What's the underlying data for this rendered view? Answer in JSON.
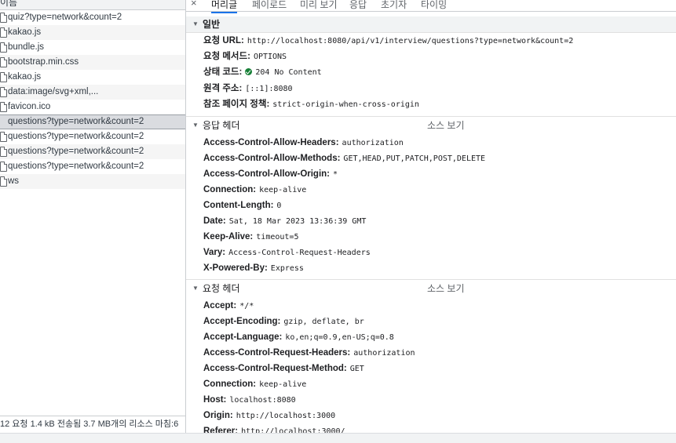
{
  "left_panel": {
    "column_header": "이름",
    "requests": [
      {
        "name": "quiz?type=network&count=2"
      },
      {
        "name": "kakao.js"
      },
      {
        "name": "bundle.js"
      },
      {
        "name": "bootstrap.min.css"
      },
      {
        "name": "kakao.js"
      },
      {
        "name": "data:image/svg+xml,..."
      },
      {
        "name": "favicon.ico"
      },
      {
        "name": "questions?type=network&count=2",
        "selected": true
      },
      {
        "name": "questions?type=network&count=2"
      },
      {
        "name": "questions?type=network&count=2"
      },
      {
        "name": "questions?type=network&count=2"
      },
      {
        "name": "ws"
      }
    ],
    "status_bar": "12 요청  1.4 kB 전송됨  3.7 MB개의 리소스  마침:6"
  },
  "tabs": {
    "close_icon": "×",
    "items": [
      "머리글",
      "페이로드",
      "미리 보기",
      "응답",
      "초기자",
      "타이밍"
    ],
    "active": 0
  },
  "general": {
    "title": "일반",
    "fields": [
      {
        "key": "요청 URL:",
        "value": "http://localhost:8080/api/v1/interview/questions?type=network&count=2"
      },
      {
        "key": "요청 메서드:",
        "value": "OPTIONS"
      },
      {
        "key": "상태 코드:",
        "value": "204 No Content",
        "status_icon": "check-circle-icon",
        "status_color": "#188038"
      },
      {
        "key": "원격 주소:",
        "value": "[::1]:8080"
      },
      {
        "key": "참조 페이지 정책:",
        "value": "strict-origin-when-cross-origin"
      }
    ]
  },
  "response_headers": {
    "title": "응답 헤더",
    "view_source": "소스 보기",
    "fields": [
      {
        "key": "Access-Control-Allow-Headers:",
        "value": "authorization"
      },
      {
        "key": "Access-Control-Allow-Methods:",
        "value": "GET,HEAD,PUT,PATCH,POST,DELETE"
      },
      {
        "key": "Access-Control-Allow-Origin:",
        "value": "*"
      },
      {
        "key": "Connection:",
        "value": "keep-alive"
      },
      {
        "key": "Content-Length:",
        "value": "0"
      },
      {
        "key": "Date:",
        "value": "Sat, 18 Mar 2023 13:36:39 GMT"
      },
      {
        "key": "Keep-Alive:",
        "value": "timeout=5"
      },
      {
        "key": "Vary:",
        "value": "Access-Control-Request-Headers"
      },
      {
        "key": "X-Powered-By:",
        "value": "Express"
      }
    ]
  },
  "request_headers": {
    "title": "요청 헤더",
    "view_source": "소스 보기",
    "fields": [
      {
        "key": "Accept:",
        "value": "*/*"
      },
      {
        "key": "Accept-Encoding:",
        "value": "gzip, deflate, br"
      },
      {
        "key": "Accept-Language:",
        "value": "ko,en;q=0.9,en-US;q=0.8"
      },
      {
        "key": "Access-Control-Request-Headers:",
        "value": "authorization"
      },
      {
        "key": "Access-Control-Request-Method:",
        "value": "GET"
      },
      {
        "key": "Connection:",
        "value": "keep-alive"
      },
      {
        "key": "Host:",
        "value": "localhost:8080"
      },
      {
        "key": "Origin:",
        "value": "http://localhost:3000"
      },
      {
        "key": "Referer:",
        "value": "http://localhost:3000/"
      }
    ]
  }
}
